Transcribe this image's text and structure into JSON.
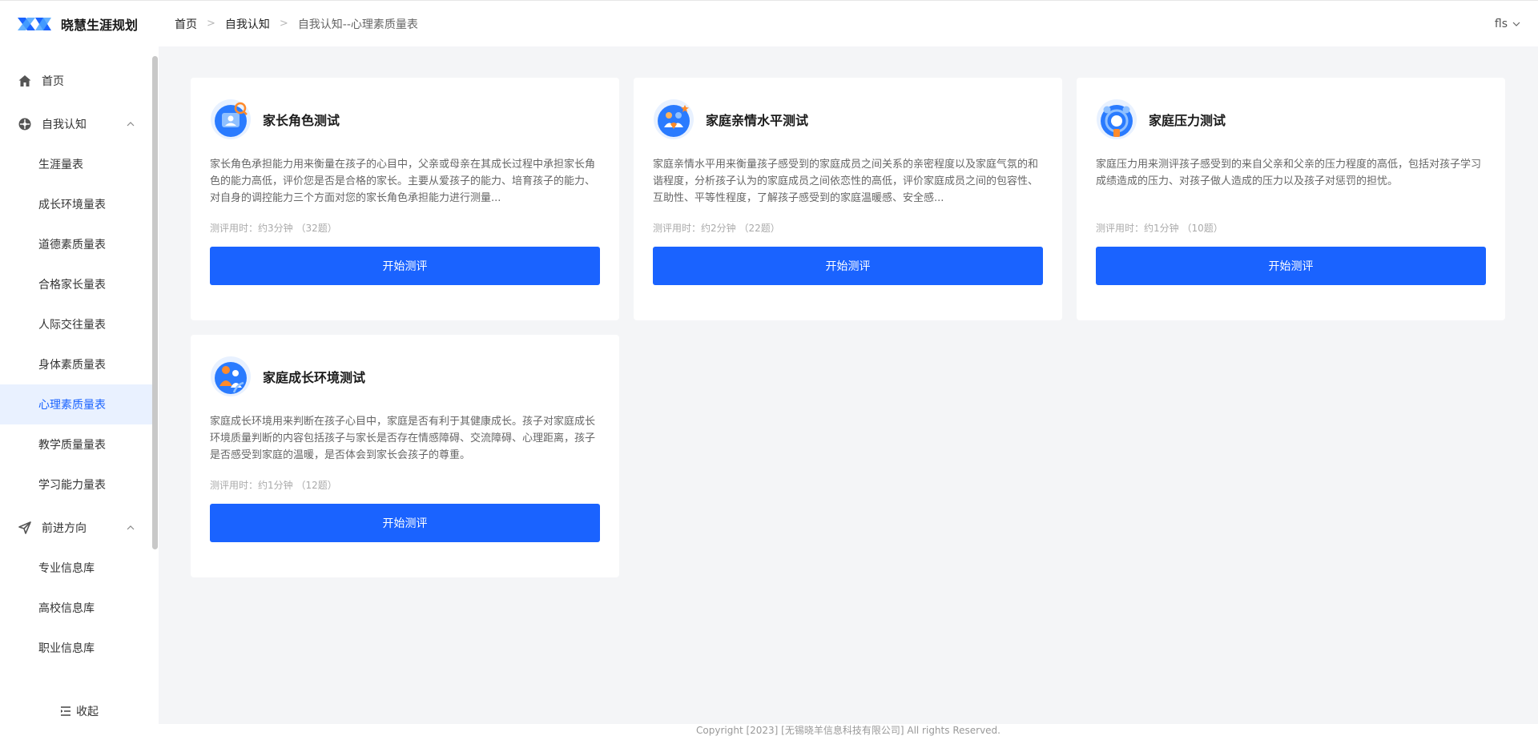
{
  "app": {
    "name": "晓慧生涯规划",
    "user": "fls"
  },
  "breadcrumb": [
    "首页",
    "自我认知",
    "自我认知--心理素质量表"
  ],
  "sidebar": {
    "home": "首页",
    "groups": [
      {
        "label": "自我认知",
        "items": [
          "生涯量表",
          "成长环境量表",
          "道德素质量表",
          "合格家长量表",
          "人际交往量表",
          "身体素质量表",
          "心理素质量表",
          "教学质量量表",
          "学习能力量表"
        ]
      },
      {
        "label": "前进方向",
        "items": [
          "专业信息库",
          "高校信息库",
          "职业信息库"
        ]
      }
    ],
    "active_item": "心理素质量表",
    "collapse_label": "收起"
  },
  "cards": [
    {
      "title": "家长角色测试",
      "desc": "家长角色承担能力用来衡量在孩子的心目中，父亲或母亲在其成长过程中承担家长角色的能力高低，评价您是否是合格的家长。主要从爱孩子的能力、培育孩子的能力、对自身的调控能力三个方面对您的家长角色承担能力进行测量...",
      "meta": "测评用时：约3分钟 （32题）",
      "button": "开始测评"
    },
    {
      "title": "家庭亲情水平测试",
      "desc": "家庭亲情水平用来衡量孩子感受到的家庭成员之间关系的亲密程度以及家庭气氛的和谐程度，分析孩子认为的家庭成员之间依恋性的高低，评价家庭成员之间的包容性、互助性、平等性程度，了解孩子感受到的家庭温暖感、安全感...",
      "meta": "测评用时：约2分钟 （22题）",
      "button": "开始测评"
    },
    {
      "title": "家庭压力测试",
      "desc": "家庭压力用来测评孩子感受到的来自父亲和父亲的压力程度的高低，包括对孩子学习成绩造成的压力、对孩子做人造成的压力以及孩子对惩罚的担忧。",
      "meta": "测评用时：约1分钟 （10题）",
      "button": "开始测评"
    },
    {
      "title": "家庭成长环境测试",
      "desc": "家庭成长环境用来判断在孩子心目中，家庭是否有利于其健康成长。孩子对家庭成长环境质量判断的内容包括孩子与家长是否存在情感障碍、交流障碍、心理距离，孩子是否感受到家庭的温暖，是否体会到家长会孩子的尊重。",
      "meta": "测评用时：约1分钟 （12题）",
      "button": "开始测评"
    }
  ],
  "footer": "Copyright [2023] [无锡晓羊信息科技有限公司] All rights Reserved.",
  "colors": {
    "primary": "#1a63ff",
    "active_bg": "#e9f1ff",
    "page_bg": "#f4f5f7"
  }
}
